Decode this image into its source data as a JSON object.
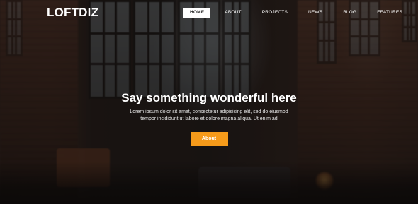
{
  "brand": {
    "logo_text": "LOFTDIZ"
  },
  "nav": {
    "items": [
      {
        "label": "HOME",
        "active": true
      },
      {
        "label": "ABOUT",
        "active": false
      },
      {
        "label": "PROJECTS",
        "active": false
      },
      {
        "label": "NEWS",
        "active": false
      },
      {
        "label": "BLOG",
        "active": false
      },
      {
        "label": "FEATURES",
        "active": false
      }
    ]
  },
  "hero": {
    "title": "Say something wonderful here",
    "text": "Lorem ipsum dolor sit amet, consectetur adipisicing elit, sed do eiusmod tempor incididunt ut labore et dolore magna aliqua. Ut enim ad",
    "button_label": "About"
  },
  "colors": {
    "accent": "#f59a1a",
    "nav_active_bg": "#ffffff",
    "text": "#ffffff"
  }
}
